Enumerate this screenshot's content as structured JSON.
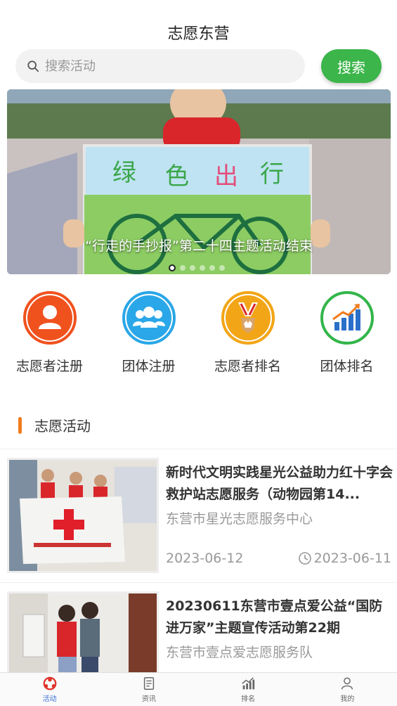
{
  "header": {
    "title": "志愿东营"
  },
  "search": {
    "placeholder": "搜索活动",
    "button_label": "搜索"
  },
  "banner": {
    "caption": "“行走的手抄报”第二十四主题活动结束",
    "poster_text": "绿 色 出 行",
    "dot_count": 6,
    "active_dot": 1
  },
  "quick_actions": [
    {
      "label": "志愿者注册",
      "icon": "person-icon",
      "color": "#f0521e"
    },
    {
      "label": "团体注册",
      "icon": "group-icon",
      "color": "#2aa7e8"
    },
    {
      "label": "志愿者排名",
      "icon": "medal-icon",
      "color": "#f2a516"
    },
    {
      "label": "团体排名",
      "icon": "trend-chart-icon",
      "color": "#33b54a"
    }
  ],
  "section": {
    "title": "志愿活动"
  },
  "activities": [
    {
      "title": "新时代文明实践星光公益助力红十字会救护站志愿服务（动物园第14...",
      "org": "东营市星光志愿服务中心",
      "start_date": "2023-06-12",
      "end_date": "2023-06-11"
    },
    {
      "title": "20230611东营市壹点爱公益“国防进万家”主题宣传活动第22期",
      "org": "东营市壹点爱志愿服务队",
      "start_date": "",
      "end_date": ""
    }
  ],
  "tabbar": {
    "items": [
      {
        "label": "活动",
        "icon": "activity-icon",
        "active": true
      },
      {
        "label": "资讯",
        "icon": "news-icon",
        "active": false
      },
      {
        "label": "排名",
        "icon": "ranking-icon",
        "active": false
      },
      {
        "label": "我的",
        "icon": "profile-icon",
        "active": false
      }
    ]
  },
  "colors": {
    "accent_green": "#3cb54a",
    "section_bar": "#f07c1e",
    "tab_active": "#3a6fd8"
  }
}
